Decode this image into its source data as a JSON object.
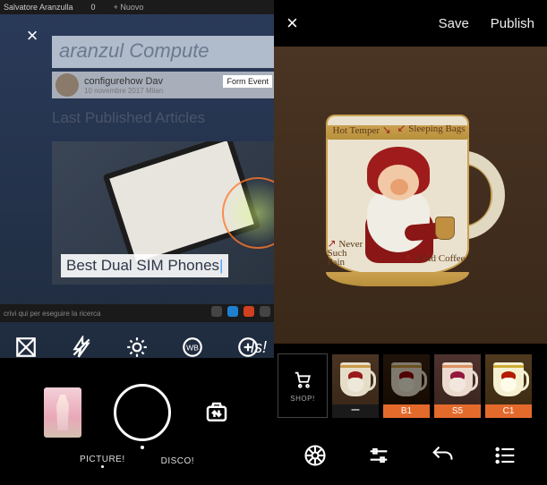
{
  "left": {
    "close_icon": "×",
    "browser": {
      "tab_label": "Salvatore Aranzulla",
      "comments_count": "0",
      "new_tab": "+ Nuovo",
      "site_title": "aranzul Compute",
      "profile_name": "configurehow Dav",
      "profile_meta": "10 novembre 2017 Milan",
      "form_event": "Form Event",
      "section_title": "Last Published Articles",
      "article_title": "Best Dual SIM Phones",
      "taskbar_hint": "crivi qui per eseguire la ricerca",
      "overlay_ls": "ls!"
    },
    "modes": {
      "picture": "PICTURE!",
      "disco": "DISCO!"
    }
  },
  "right": {
    "close": "×",
    "save": "Save",
    "publish": "Publish",
    "mug": {
      "hot_temper": "Hot Temper",
      "sleeping_bags": "Sleeping Bags",
      "never_such_pain": "Never Such Pain",
      "cold_coffee": "Cold Coffee"
    },
    "shop_label": "SHOP!",
    "filters": [
      {
        "label": "–",
        "class": "dash"
      },
      {
        "label": "B1",
        "class": "orange"
      },
      {
        "label": "S5",
        "class": "orange"
      },
      {
        "label": "C1",
        "class": "orange"
      }
    ]
  }
}
